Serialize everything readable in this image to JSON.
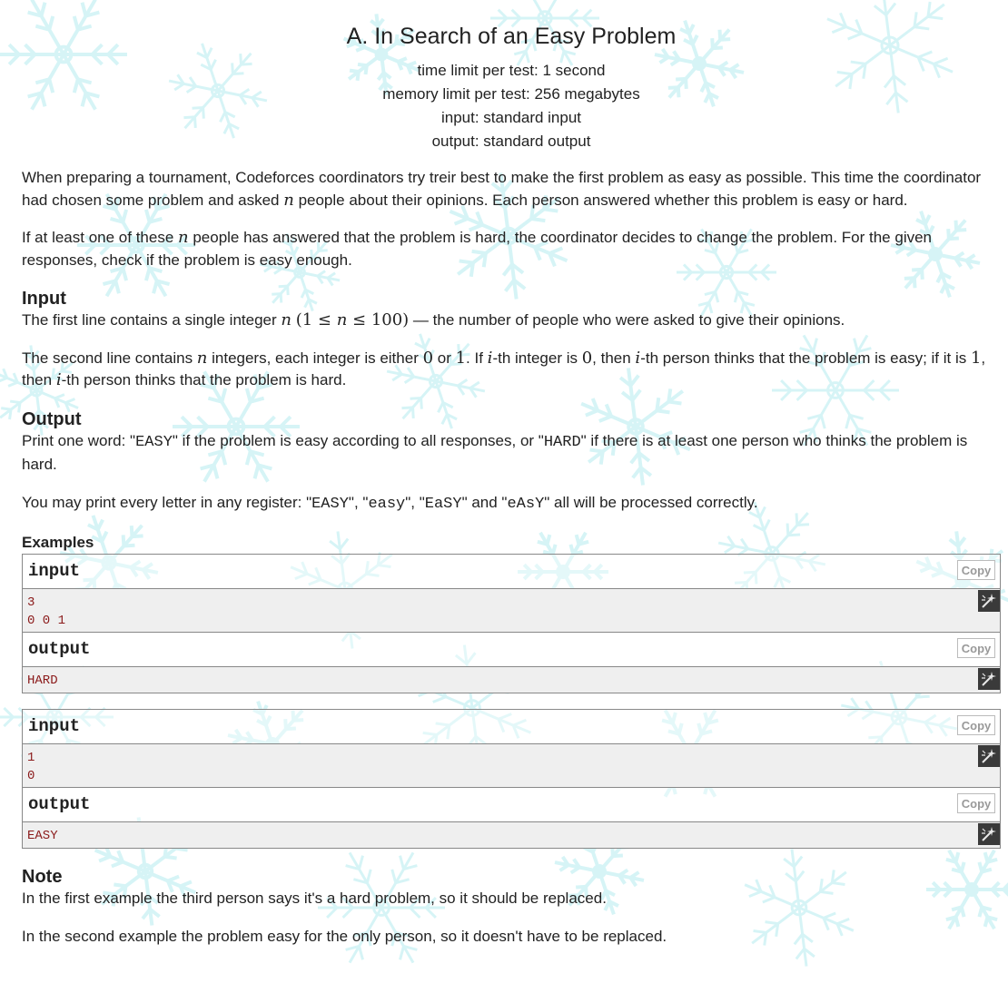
{
  "problem": {
    "title": "A. In Search of an Easy Problem",
    "limits": [
      "time limit per test: 1 second",
      "memory limit per test: 256 megabytes",
      "input: standard input",
      "output: standard output"
    ]
  },
  "statement": {
    "p1": {
      "a": "When preparing a tournament, Codeforces coordinators try treir best to make the first problem as easy as possible. This time the coordinator had chosen some problem and asked ",
      "n": "n",
      "b": " people about their opinions. Each person answered whether this problem is easy or hard."
    },
    "p2": {
      "a": "If at least one of these ",
      "n": "n",
      "b": " people has answered that the problem is hard, the coordinator decides to change the problem. For the given responses, check if the problem is easy enough."
    }
  },
  "input_section": {
    "title": "Input",
    "p1": {
      "a": "The first line contains a single integer ",
      "n": "n",
      "open": "(1 ≤ ",
      "n2": "n",
      "close": " ≤ 100)",
      "b": " — the number of people who were asked to give their opinions."
    },
    "p2": {
      "a": "The second line contains ",
      "n": "n",
      "b": " integers, each integer is either ",
      "zero": "0",
      "c": " or ",
      "one": "1",
      "d": ". If ",
      "i1": "i",
      "e": "-th integer is ",
      "zero2": "0",
      "f": ", then ",
      "i2": "i",
      "g": "-th person thinks that the problem is easy; if it is ",
      "one2": "1",
      "h": ", then ",
      "i3": "i",
      "j": "-th person thinks that the problem is hard."
    }
  },
  "output_section": {
    "title": "Output",
    "p1": {
      "a": "Print one word: \"",
      "easy": "EASY",
      "b": "\" if the problem is easy according to all responses, or \"",
      "hard": "HARD",
      "c": "\" if there is at least one person who thinks the problem is hard."
    },
    "p2": {
      "a": "You may print every letter in any register: \"",
      "v1": "EASY",
      "b": "\", \"",
      "v2": "easy",
      "c": "\", \"",
      "v3": "EaSY",
      "d": "\" and \"",
      "v4": "eAsY",
      "e": "\" all will be processed correctly."
    }
  },
  "examples": {
    "title": "Examples",
    "input_label": "input",
    "output_label": "output",
    "copy_label": "Copy",
    "tests": [
      {
        "input": [
          "3",
          "0 0 1"
        ],
        "output": [
          "HARD"
        ]
      },
      {
        "input": [
          "1",
          "0"
        ],
        "output": [
          "EASY"
        ]
      }
    ]
  },
  "note": {
    "title": "Note",
    "p1": "In the first example the third person says it's a hard problem, so it should be replaced.",
    "p2": "In the second example the problem easy for the only person, so it doesn't have to be replaced."
  },
  "colors": {
    "background": "#ffffff",
    "snowflake": "#c9f1f4",
    "text": "#222222",
    "example_text": "#8b1a1a",
    "example_bg": "#efefef",
    "border": "#888888"
  },
  "icons": [
    "copy-button",
    "wand-icon",
    "snowflake-icon"
  ]
}
